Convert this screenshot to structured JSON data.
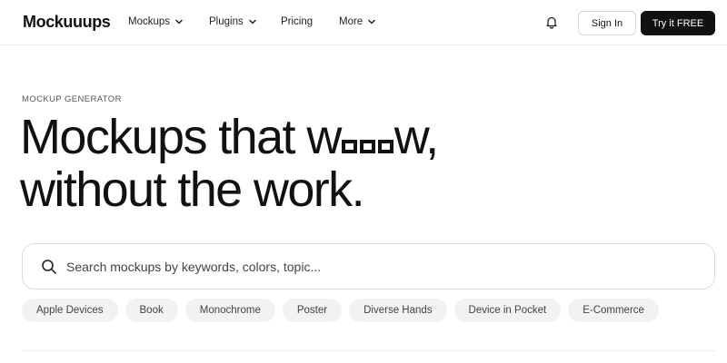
{
  "brand": {
    "logo": "Mockuuups"
  },
  "nav": {
    "items": [
      {
        "label": "Mockups",
        "has_dropdown": true
      },
      {
        "label": "Plugins",
        "has_dropdown": true
      },
      {
        "label": "Pricing",
        "has_dropdown": false
      },
      {
        "label": "More",
        "has_dropdown": true
      }
    ],
    "bell_icon": "bell-icon",
    "sign_in_label": "Sign In",
    "try_label": "Try it FREE"
  },
  "hero": {
    "eyebrow": "MOCKUP GENERATOR",
    "headline_line1_prefix": "Mockups that w",
    "headline_line1_suffix": "w,",
    "headline_line2": "without the work."
  },
  "search": {
    "placeholder": "Search mockups by keywords, colors, topic...",
    "value": "",
    "icon": "search-icon"
  },
  "tags": [
    "Apple Devices",
    "Book",
    "Monochrome",
    "Poster",
    "Diverse Hands",
    "Device in Pocket",
    "E-Commerce"
  ],
  "colors": {
    "primary_button": "#111111",
    "chip_bg": "#f2f2f2",
    "border": "#dcdcdc"
  }
}
